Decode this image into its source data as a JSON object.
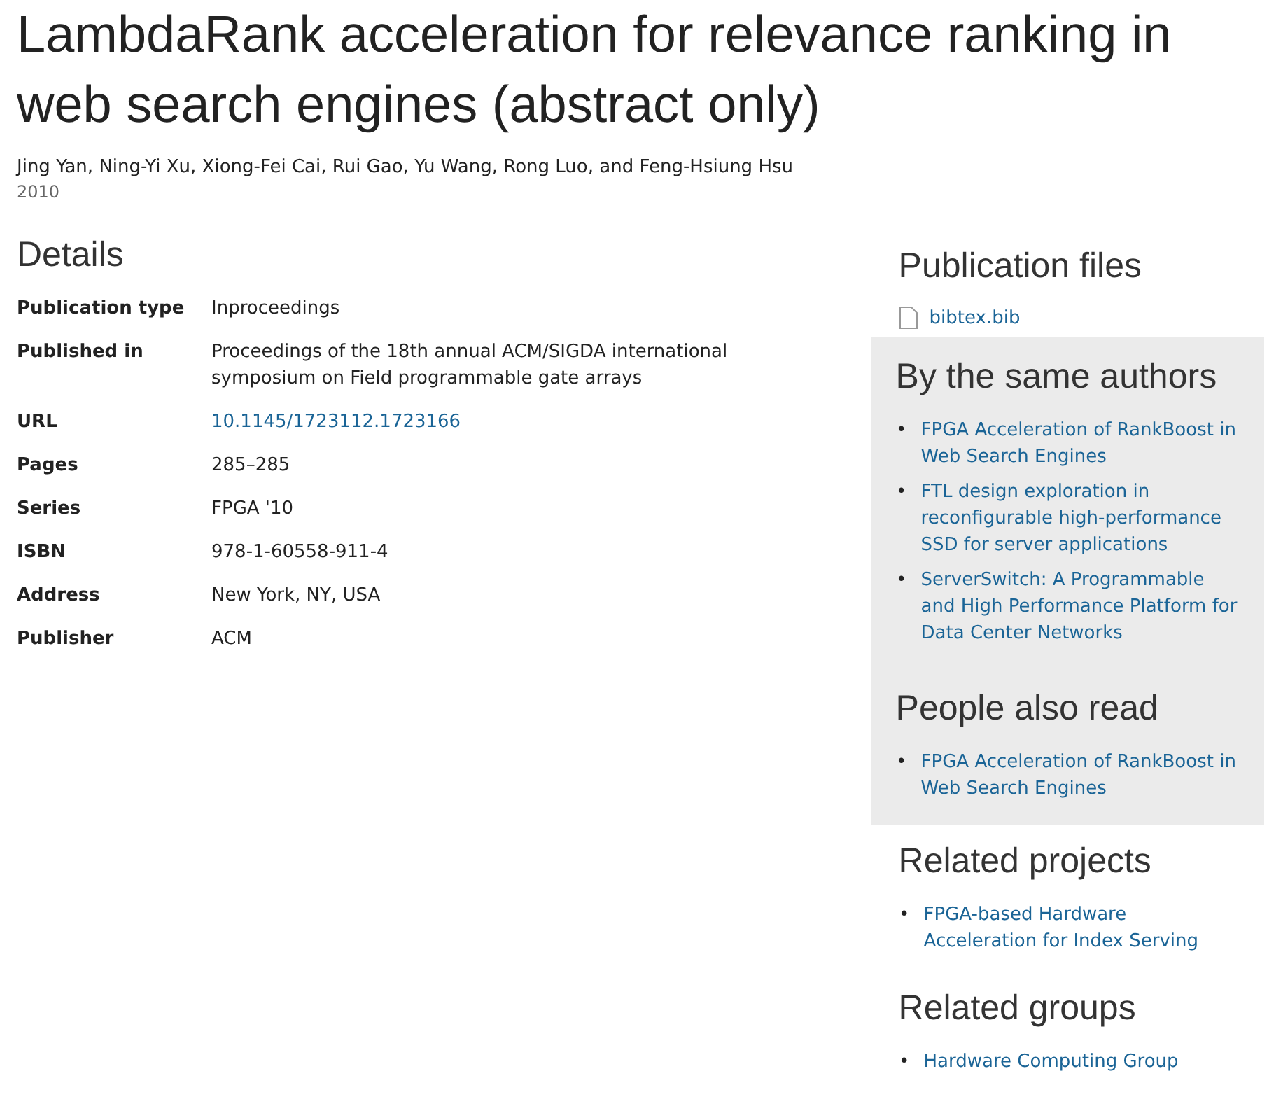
{
  "title": "LambdaRank acceleration for relevance ranking in web search engines (abstract only)",
  "authors": "Jing Yan, Ning-Yi Xu, Xiong-Fei Cai, Rui Gao, Yu Wang, Rong Luo, and Feng-Hsiung Hsu",
  "year": "2010",
  "details": {
    "heading": "Details",
    "rows": [
      {
        "label": "Publication type",
        "value": "Inproceedings",
        "kind": "text"
      },
      {
        "label": "Published in",
        "value": "Proceedings of the 18th annual ACM/SIGDA international symposium on Field programmable gate arrays",
        "kind": "text"
      },
      {
        "label": "URL",
        "value": "10.1145/1723112.1723166",
        "kind": "link"
      },
      {
        "label": "Pages",
        "value": "285–285",
        "kind": "text"
      },
      {
        "label": "Series",
        "value": "FPGA '10",
        "kind": "text"
      },
      {
        "label": "ISBN",
        "value": "978-1-60558-911-4",
        "kind": "text"
      },
      {
        "label": "Address",
        "value": "New York, NY, USA",
        "kind": "text"
      },
      {
        "label": "Publisher",
        "value": "ACM",
        "kind": "text"
      }
    ]
  },
  "sidebar": [
    {
      "heading": "Publication files",
      "kind": "files",
      "shaded": false,
      "items": [
        "bibtex.bib"
      ]
    },
    {
      "heading": "By the same authors",
      "kind": "list",
      "bullet": "•",
      "shaded": true,
      "items": [
        "FPGA Acceleration of RankBoost in Web Search Engines",
        "FTL design exploration in reconfigurable high-performance SSD for server applications",
        "ServerSwitch: A Programmable and High Performance Platform for Data Center Networks"
      ]
    },
    {
      "heading": "People also read",
      "kind": "list",
      "bullet": "•",
      "shaded": true,
      "items": [
        "FPGA Acceleration of RankBoost in Web Search Engines"
      ]
    },
    {
      "heading": "Related projects",
      "kind": "list",
      "bullet": "•",
      "shaded": false,
      "items": [
        "FPGA-based Hardware Acceleration for Index Serving"
      ]
    },
    {
      "heading": "Related groups",
      "kind": "list",
      "bullet": "•",
      "shaded": false,
      "items": [
        "Hardware Computing Group"
      ]
    }
  ]
}
